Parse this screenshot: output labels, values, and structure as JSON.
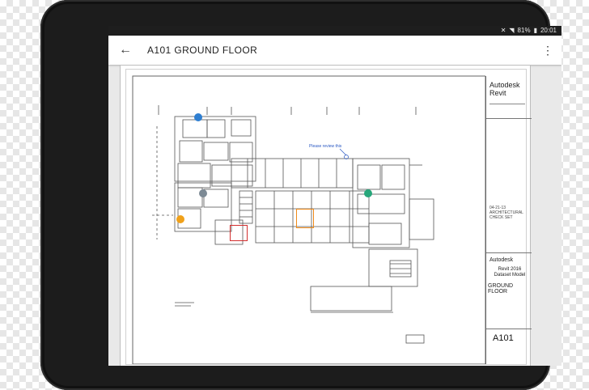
{
  "status_bar": {
    "battery": "81%",
    "time": "20:01"
  },
  "app_bar": {
    "title": "A101 GROUND FLOOR"
  },
  "titleblock": {
    "brand": "Autodesk Revit",
    "description": "04-21-13 ARCHITECTURAL CHECK SET",
    "company": "Autodesk",
    "project": "Revit 2016 Dataset Model",
    "sheet_name": "GROUND FLOOR",
    "sheet_number": "A101"
  },
  "annotations": {
    "comment": "Please review this"
  },
  "colors": {
    "marker_blue": "#2f7fd1",
    "marker_green": "#27a67a",
    "marker_gray": "#7d8a95",
    "marker_orange": "#f0a11a",
    "redline": "#d32f2f",
    "orangeline": "#ef8a1a"
  }
}
